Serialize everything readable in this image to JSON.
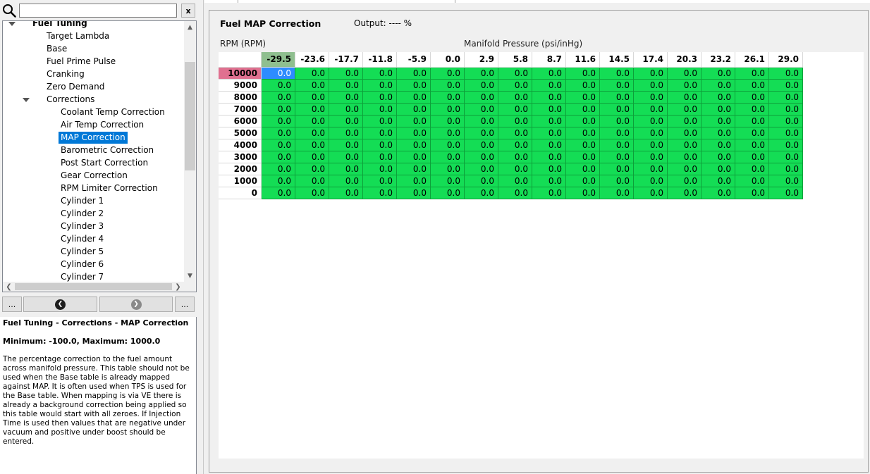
{
  "search": {
    "value": "",
    "placeholder": "",
    "clear_label": "x"
  },
  "tree": {
    "items": [
      {
        "label": "Fuel Tuning",
        "level": 0,
        "expanded": true,
        "bold": true
      },
      {
        "label": "Target Lambda",
        "level": 1
      },
      {
        "label": "Base",
        "level": 1
      },
      {
        "label": "Fuel Prime Pulse",
        "level": 1
      },
      {
        "label": "Cranking",
        "level": 1
      },
      {
        "label": "Zero Demand",
        "level": 1
      },
      {
        "label": "Corrections",
        "level": 1,
        "expanded": true
      },
      {
        "label": "Coolant Temp Correction",
        "level": 2
      },
      {
        "label": "Air Temp Correction",
        "level": 2
      },
      {
        "label": "MAP Correction",
        "level": 2,
        "selected": true
      },
      {
        "label": "Barometric Correction",
        "level": 2
      },
      {
        "label": "Post Start Correction",
        "level": 2
      },
      {
        "label": "Gear Correction",
        "level": 2
      },
      {
        "label": "RPM Limiter Correction",
        "level": 2
      },
      {
        "label": "Cylinder 1",
        "level": 2
      },
      {
        "label": "Cylinder 2",
        "level": 2
      },
      {
        "label": "Cylinder 3",
        "level": 2
      },
      {
        "label": "Cylinder 4",
        "level": 2
      },
      {
        "label": "Cylinder 5",
        "level": 2
      },
      {
        "label": "Cylinder 6",
        "level": 2
      },
      {
        "label": "Cylinder 7",
        "level": 2
      }
    ]
  },
  "nav": {
    "more_left_label": "...",
    "more_right_label": "..."
  },
  "help": {
    "title": "Fuel Tuning - Corrections - MAP Correction",
    "minmax": "Minimum: -100.0, Maximum: 1000.0",
    "description": "The percentage correction to the fuel amount across manifold pressure. This table should not be used when the Base table is already mapped against MAP. It is often used when TPS is used for the Base table. When mapping is via VE there is already a background correction being applied so this table would start with all zeroes. If Injection Time is used then values that are negative under vacuum and positive under boost should be entered."
  },
  "table": {
    "title": "Fuel MAP Correction",
    "output": "Output: ---- %",
    "rpm_label": "RPM (RPM)",
    "map_label": "Manifold Pressure (psi/inHg)",
    "columns": [
      "-29.5",
      "-23.6",
      "-17.7",
      "-11.8",
      "-5.9",
      "0.0",
      "2.9",
      "5.8",
      "8.7",
      "11.6",
      "14.5",
      "17.4",
      "20.3",
      "23.2",
      "26.1",
      "29.0"
    ],
    "rows": [
      "10000",
      "9000",
      "8000",
      "7000",
      "6000",
      "5000",
      "4000",
      "3000",
      "2000",
      "1000",
      "0"
    ],
    "cell_value": "0.0",
    "active_col": 0,
    "active_row": 0,
    "colors": {
      "cell": "#14dd55",
      "selected_cell": "#2d8cff",
      "active_row_header": "#e07090",
      "active_col_header": "#8fbf8f"
    }
  },
  "icons": {
    "search": "search-icon",
    "clear": "close-icon",
    "back": "back-arrow-icon",
    "forward": "forward-arrow-icon"
  }
}
